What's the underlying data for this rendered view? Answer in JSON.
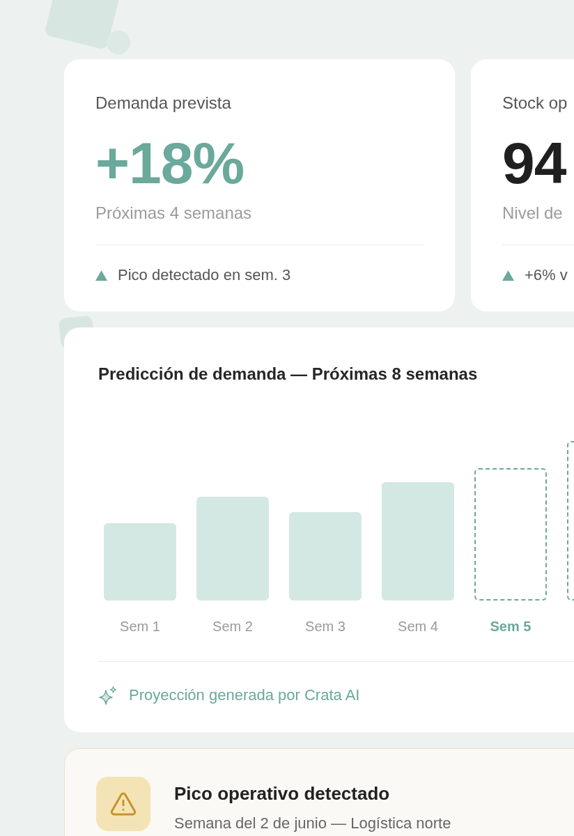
{
  "kpi_cards": [
    {
      "title": "Demanda prevista",
      "value": "+18%",
      "kind": "accent",
      "caption": "Próximas 4 semanas",
      "note": {
        "text": "Pico detectado en sem. 3",
        "kind": "up"
      }
    },
    {
      "title": "Stock op",
      "value": "94",
      "kind": "plain",
      "caption": "Nivel de",
      "note": {
        "text": "+6% v",
        "kind": "up"
      }
    }
  ],
  "forecast_chart": {
    "title": "Predicción de demanda — Próximas 8 semanas",
    "bars": [
      {
        "label": "Sem 1",
        "kind": "actual"
      },
      {
        "label": "Sem 2",
        "kind": "actual"
      },
      {
        "label": "Sem 3",
        "kind": "actual"
      },
      {
        "label": "Sem 4",
        "kind": "actual"
      },
      {
        "label": "Sem 5",
        "kind": "forecast"
      },
      {
        "kind": "forecast"
      }
    ],
    "footer": "Proyección generada por Crata AI"
  },
  "alert": {
    "kind": "warning",
    "title": "Pico operativo detectado",
    "subtitle": "Semana del 2 de junio — Logística norte"
  }
}
